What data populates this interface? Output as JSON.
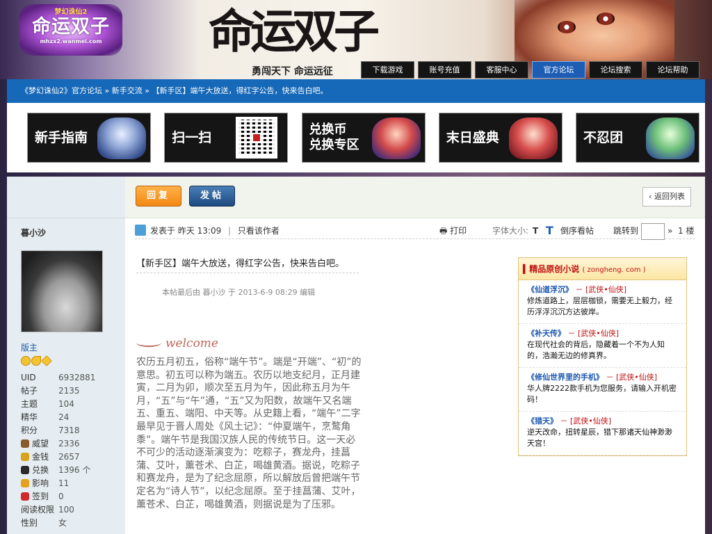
{
  "header": {
    "logo": {
      "line1": "梦幻诛仙2",
      "line2": "命运双子",
      "line3": "mhzx2.wanmei.com"
    },
    "title": "命运双子",
    "slogan": "勇闯天下 命运远征",
    "nav": [
      "下载游戏",
      "账号充值",
      "客服中心",
      "官方论坛",
      "论坛搜索",
      "论坛帮助"
    ],
    "active_nav": "官方论坛"
  },
  "breadcrumb": "《梦幻诛仙2》官方论坛 » 新手交流 » 【新手区】端午大放送，得红字公告，快来告白吧。",
  "banners": [
    "新手指南",
    "扫一扫",
    "兑换币\n兑换专区",
    "末日盛典",
    "不忍团"
  ],
  "toolbar": {
    "reply": "回复",
    "post": "发帖",
    "back": "返回列表"
  },
  "post_bar": {
    "posted": "发表于 昨天 13:09",
    "sep": "|",
    "only_author": "只看该作者",
    "print": "打印",
    "font_size": "字体大小:",
    "font_t1": "T",
    "font_t2": "T",
    "reverse": "倒序看帖",
    "jump": "跳转到",
    "arrow": "»",
    "floor": "1 楼"
  },
  "author": {
    "name": "暮小沙",
    "role": "版主",
    "stats": [
      {
        "k": "UID",
        "v": "6932881"
      },
      {
        "k": "帖子",
        "v": "2135"
      },
      {
        "k": "主题",
        "v": "104"
      },
      {
        "k": "精华",
        "v": "24"
      },
      {
        "k": "积分",
        "v": "7318"
      },
      {
        "k": "威望",
        "v": "2336",
        "icon": "prestige-icon",
        "color": "#8a5a2b"
      },
      {
        "k": "金钱",
        "v": "2657",
        "icon": "money-icon",
        "color": "#d9a21b"
      },
      {
        "k": "兑换",
        "v": "1396 个",
        "icon": "exchange-icon",
        "color": "#2a2a2a"
      },
      {
        "k": "影响",
        "v": "11",
        "icon": "influence-icon",
        "color": "#e3a21a"
      },
      {
        "k": "签到",
        "v": "0",
        "icon": "checkin-icon",
        "color": "#d22a2a"
      },
      {
        "k": "阅读权限",
        "v": "100"
      },
      {
        "k": "性别",
        "v": "女"
      }
    ]
  },
  "post": {
    "title": "【新手区】端午大放送，得红字公告，快来告白吧。",
    "edited": "本帖最后由 暮小沙 于 2013-6-9 08:29 编辑",
    "welcome": "welcome",
    "body": "农历五月初五，俗称“端午节”。端是“开端”、“初”的意思。初五可以称为端五。农历以地支纪月，正月建寅，二月为卯，顺次至五月为午，因此称五月为午月，“五”与“午”通，“五”又为阳数，故端午又名端五、重五、端阳、中天等。从史籍上看，“端午”二字最早见于晋人周处《风土记》：“仲夏端午，烹鹜角黍”。端午节是我国汉族人民的传统节日。这一天必不可少的活动逐渐演变为：吃粽子，赛龙舟，挂菖蒲、艾叶，薰苍术、白芷，喝雄黄酒。据说，吃粽子和赛龙舟，是为了纪念屈原，所以解放后曾把端午节定名为“诗人节”，以纪念屈原。至于挂菖蒲、艾叶，薰苍术、白芷，喝雄黄酒，则据说是为了压邪。"
  },
  "ad": {
    "title": "精品原创小说",
    "sub": "( zongheng. com )",
    "items": [
      {
        "title": "《仙道浮沉》",
        "cat": "－ [武侠•仙侠]",
        "desc": "修炼道路上，层层枷锁，需要无上毅力，经历浮浮沉沉方达彼岸。"
      },
      {
        "title": "《补天传》",
        "cat": "－ [武侠•仙侠]",
        "desc": "在现代社会的背后，隐藏着一个不为人知的，浩瀚无边的修真界。"
      },
      {
        "title": "《修仙世界里的手机》",
        "cat": "－ [武侠•仙侠]",
        "desc": "华人牌2222款手机为您服务，请输入开机密码！"
      },
      {
        "title": "《猎天》",
        "cat": "－ [武侠•仙侠]",
        "desc": "逆天改命，扭转星辰，猎下那诸天仙神渺渺天宫！"
      }
    ]
  }
}
